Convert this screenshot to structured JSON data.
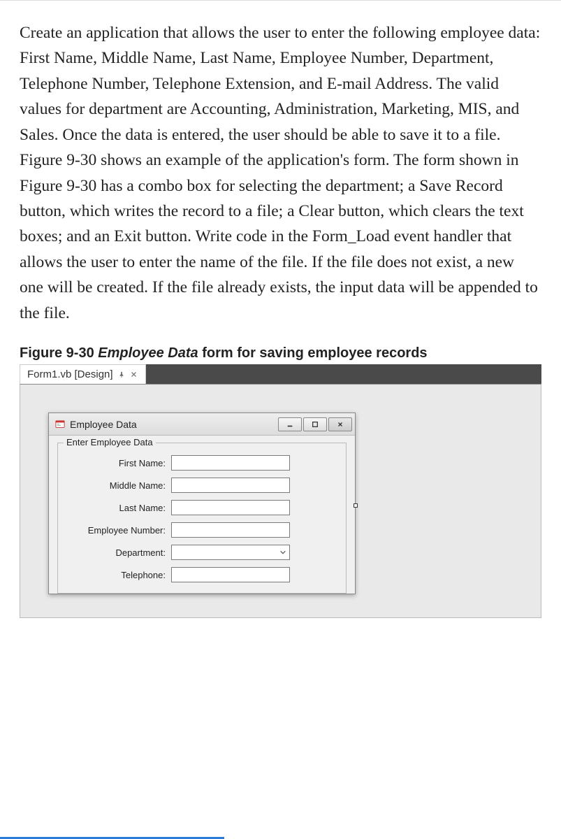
{
  "problem_text": "Create an application that allows the user to enter the following employee data: First Name, Middle Name, Last Name, Employee Number, Department, Telephone Number, Telephone Extension, and E-mail Address. The valid values for department are Accounting, Administration, Marketing, MIS, and Sales. Once the data is entered, the user should be able to save it to a file. Figure 9-30 shows an example of the application's form. The form shown in Figure 9-30 has a combo box for selecting the department; a Save Record button, which writes the record to a file; a Clear button, which clears the text boxes; and an Exit button. Write code in the Form_Load event handler that allows the user to enter the name of the file. If the file does not exist, a new one will be created. If the file already exists, the input data will be appended to the file.",
  "figure": {
    "caption_prefix": "Figure 9-30 ",
    "caption_italic": "Employee Data",
    "caption_suffix": " form for saving employee records"
  },
  "tab": {
    "label": "Form1.vb [Design]"
  },
  "window": {
    "title": "Employee Data",
    "groupbox_title": "Enter Employee Data",
    "fields": {
      "first_name": "First Name:",
      "middle_name": "Middle Name:",
      "last_name": "Last Name:",
      "employee_number": "Employee Number:",
      "department": "Department:",
      "telephone": "Telephone:"
    }
  }
}
